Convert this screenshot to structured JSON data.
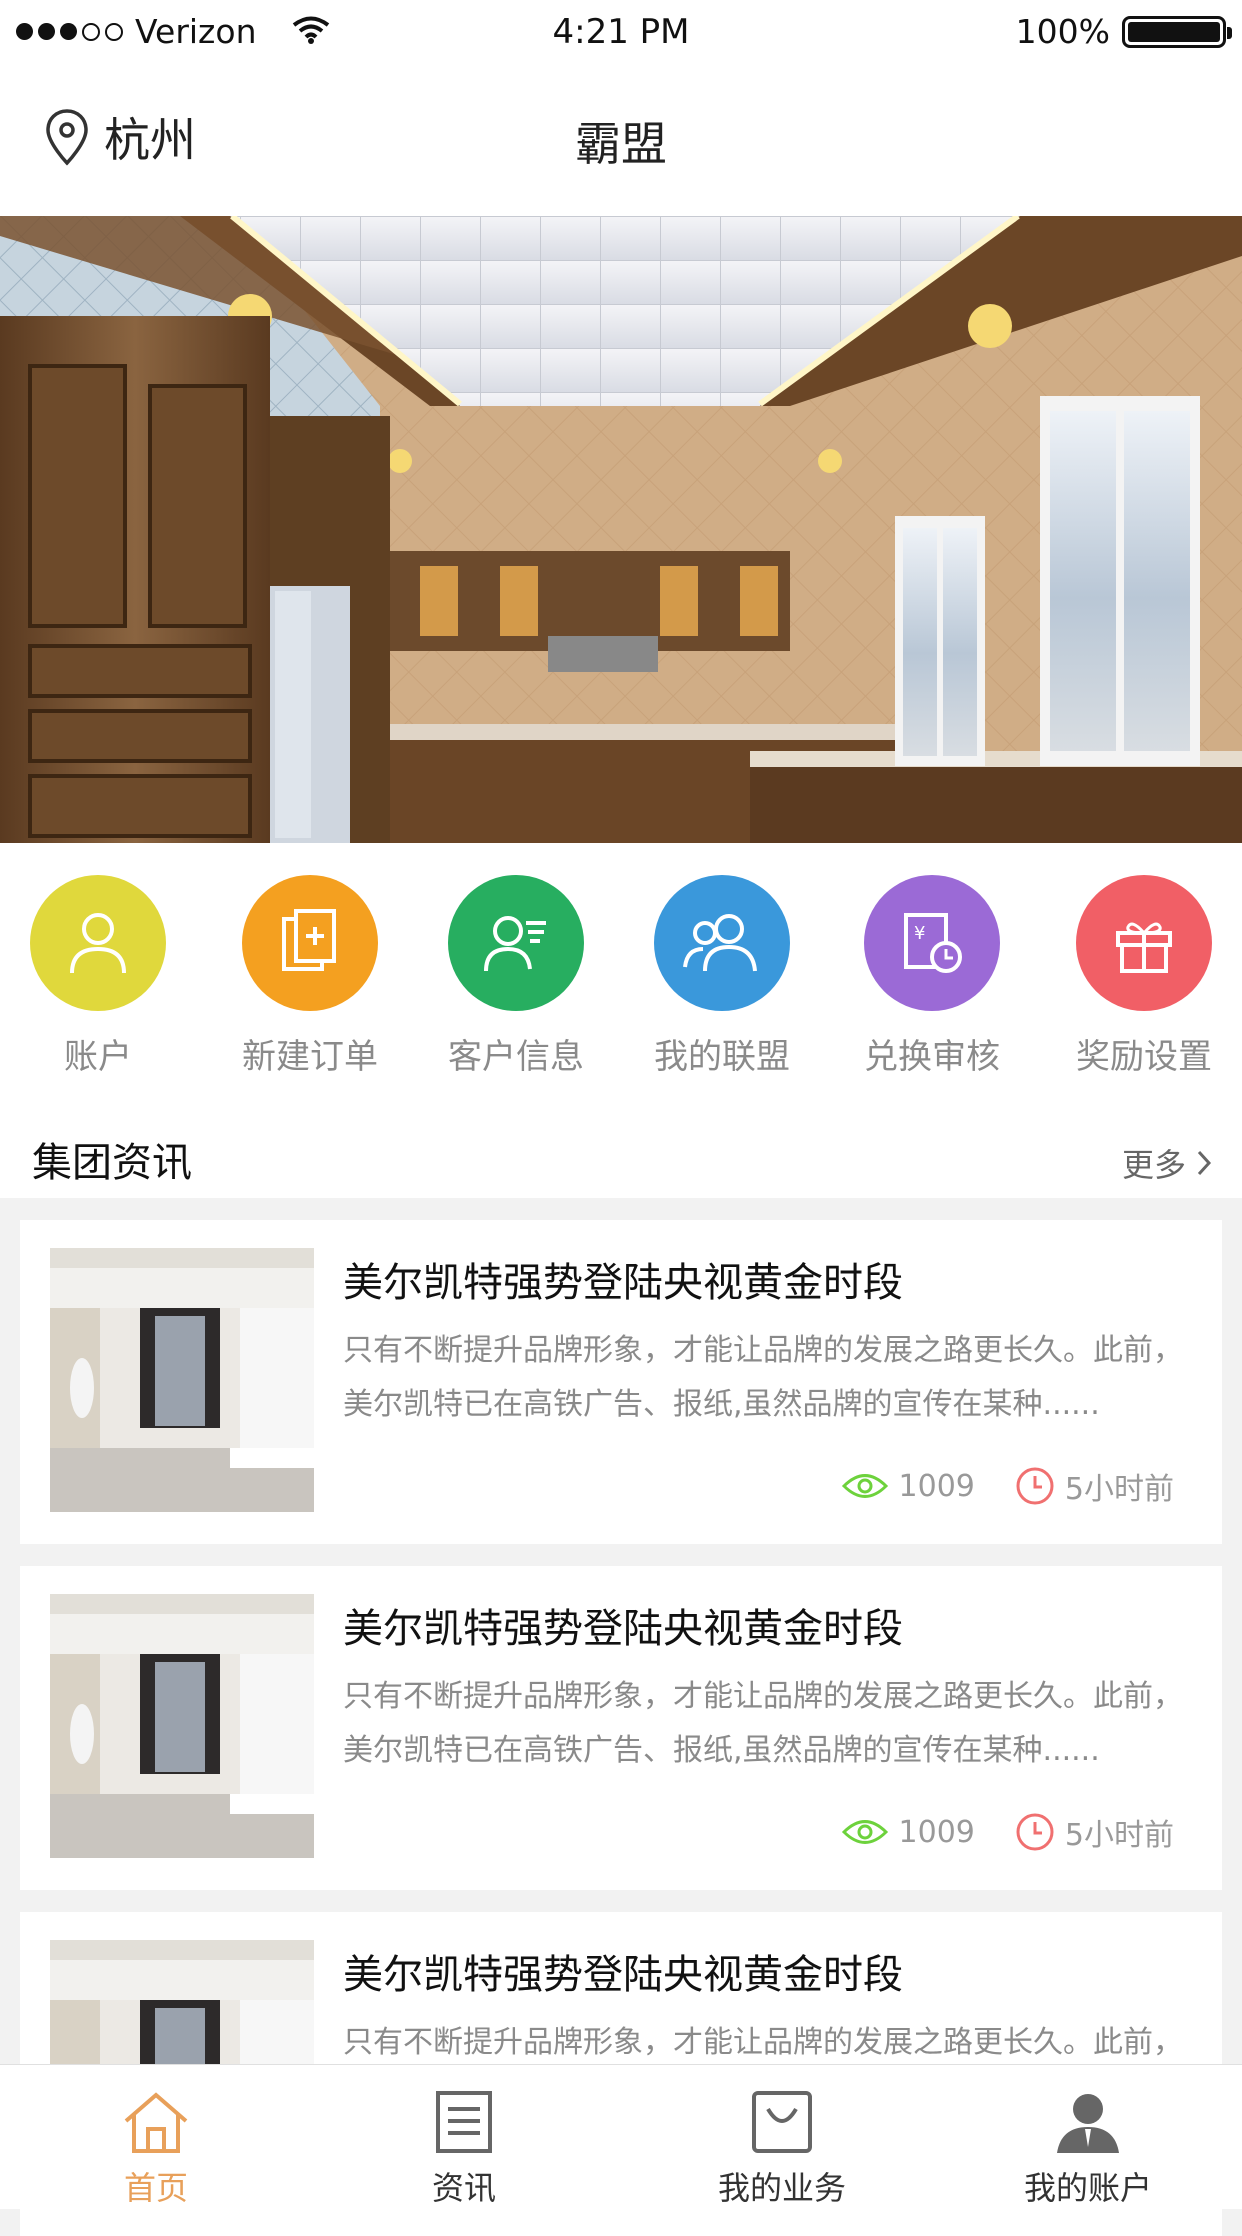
{
  "status_bar": {
    "carrier": "Verizon",
    "time": "4:21 PM",
    "battery": "100%"
  },
  "header": {
    "location": "杭州",
    "title": "霸盟"
  },
  "shortcuts": [
    {
      "label": "账户",
      "icon": "person-icon",
      "color": "#e0d83c"
    },
    {
      "label": "新建订单",
      "icon": "new-document-icon",
      "color": "#f4a020"
    },
    {
      "label": "客户信息",
      "icon": "customer-info-icon",
      "color": "#27ae60"
    },
    {
      "label": "我的联盟",
      "icon": "group-icon",
      "color": "#3a98db"
    },
    {
      "label": "兑换审核",
      "icon": "exchange-review-icon",
      "color": "#9b6ad6"
    },
    {
      "label": "奖励设置",
      "icon": "gift-icon",
      "color": "#f15f66"
    }
  ],
  "section": {
    "title": "集团资讯",
    "more": "更多"
  },
  "news": [
    {
      "title": "美尔凯特强势登陆央视黄金时段",
      "summary": "只有不断提升品牌形象，才能让品牌的发展之路更长久。此前，美尔凯特已在高铁广告、报纸,虽然品牌的宣传在某种......",
      "views": "1009",
      "time": "5小时前"
    },
    {
      "title": "美尔凯特强势登陆央视黄金时段",
      "summary": "只有不断提升品牌形象，才能让品牌的发展之路更长久。此前，美尔凯特已在高铁广告、报纸,虽然品牌的宣传在某种......",
      "views": "1009",
      "time": "5小时前"
    },
    {
      "title": "美尔凯特强势登陆央视黄金时段",
      "summary": "只有不断提升品牌形象，才能让品牌的发展之路更长久。此前，"
    }
  ],
  "tabbar": [
    {
      "label": "首页",
      "icon": "home-icon"
    },
    {
      "label": "资讯",
      "icon": "news-icon"
    },
    {
      "label": "我的业务",
      "icon": "business-bag-icon"
    },
    {
      "label": "我的账户",
      "icon": "account-user-icon"
    }
  ],
  "colors": {
    "accent": "#e8a05a",
    "eye_icon": "#6dd23c",
    "clock_icon": "#f07070"
  }
}
